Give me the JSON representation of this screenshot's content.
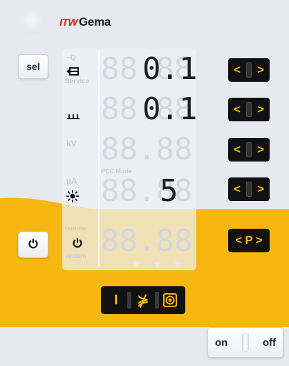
{
  "brand": {
    "itw": "ITW",
    "gema": "Gema"
  },
  "buttons": {
    "sel": "sel",
    "on": "on",
    "off": "off",
    "p": "P",
    "left_arrow": "<",
    "right_arrow": ">"
  },
  "rows": [
    {
      "id": "flow",
      "faint_top": "~Q",
      "faint_bottom": "Service",
      "value": "0.1",
      "ghost": "88.88"
    },
    {
      "id": "volume",
      "faint_top": "",
      "faint_bottom": "",
      "value": "0.1",
      "ghost": "88.88"
    },
    {
      "id": "kv",
      "faint_top": "kV",
      "faint_bottom": "",
      "value": "",
      "ghost": "88.88"
    },
    {
      "id": "ua",
      "faint_top": "µA",
      "faint_bottom": "",
      "value": "5",
      "ghost": "88.88"
    },
    {
      "id": "remote",
      "faint_top": "remote",
      "faint_bottom": "system",
      "value": "",
      "ghost": "88.88"
    }
  ],
  "pcc_mode_label": "PCC Mode",
  "mode_bar": {
    "manual": "I",
    "automatic": "⋡"
  },
  "icons": {
    "led": "status-led",
    "air": "air-flow-icon",
    "electrode_rinse": "electrode-rinse-icon",
    "current": "current-limit-icon",
    "power": "power-icon",
    "target": "target-icon"
  },
  "colors": {
    "yellow": "#f6b710",
    "background": "#e6e9ef",
    "button_dark": "#111111",
    "logo_red": "#e1261c"
  }
}
